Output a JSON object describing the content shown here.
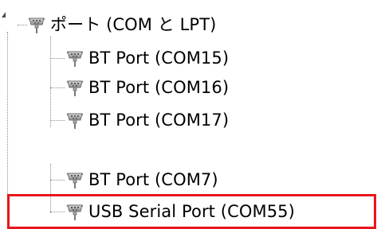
{
  "tree": {
    "category": {
      "label": "ポート (COM と LPT)",
      "icon": "serial-port-icon",
      "expanded": true
    },
    "items": [
      {
        "label": "BT Port (COM15)",
        "icon": "serial-port-icon"
      },
      {
        "label": "BT Port (COM16)",
        "icon": "serial-port-icon"
      },
      {
        "label": "BT Port (COM17)",
        "icon": "serial-port-icon"
      },
      {
        "label": "BT Port (COM7)",
        "icon": "serial-port-icon"
      },
      {
        "label": "USB Serial Port (COM55)",
        "icon": "serial-port-icon",
        "highlighted": true
      }
    ]
  },
  "colors": {
    "highlight": "#e8161b",
    "guide": "#8a8a8a",
    "icon_body": "#9a9a9a"
  }
}
